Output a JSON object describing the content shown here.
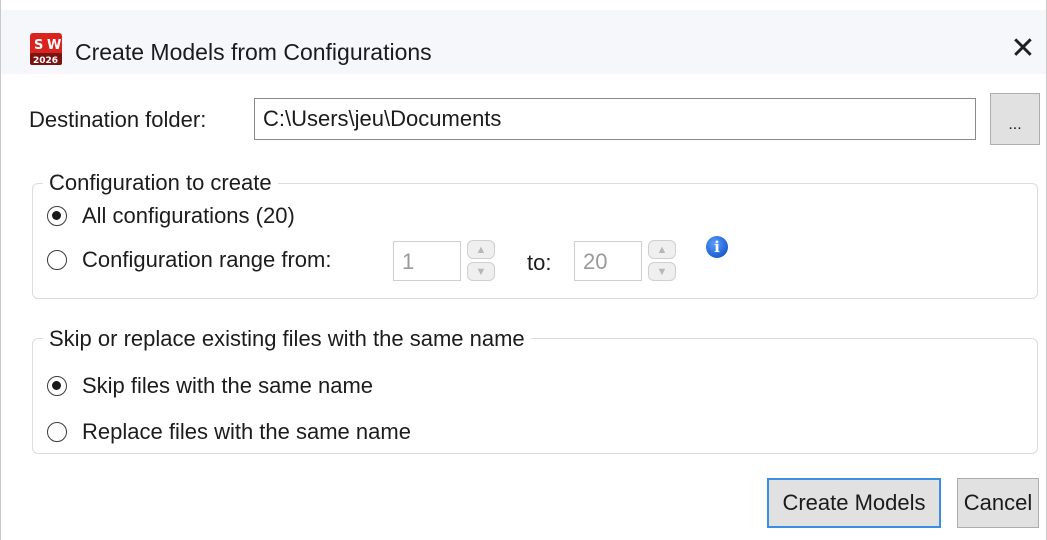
{
  "window": {
    "title": "Create Models from Configurations",
    "app_icon": "solidworks-2026-icon",
    "close_symbol": "✕"
  },
  "destination": {
    "label": "Destination folder:",
    "value": "C:\\Users\\jeu\\Documents",
    "browse_label": "..."
  },
  "config_group": {
    "legend": "Configuration to create",
    "all_label": "All configurations (20)",
    "all_selected": true,
    "range_label": "Configuration range from:",
    "range_selected": false,
    "from_value": "1",
    "to_label": "to:",
    "to_value": "20",
    "info_icon": "info-icon"
  },
  "skip_group": {
    "legend": "Skip or replace existing files with the same name",
    "skip_label": "Skip files with the same name",
    "skip_selected": true,
    "replace_label": "Replace files with the same name",
    "replace_selected": false
  },
  "buttons": {
    "create_label": "Create Models",
    "cancel_label": "Cancel"
  },
  "colors": {
    "accent": "#3c8fe0",
    "titlebar_bg": "#f5f7fb",
    "button_bg": "#e1e1e1",
    "info_blue": "#1b5fd0"
  }
}
